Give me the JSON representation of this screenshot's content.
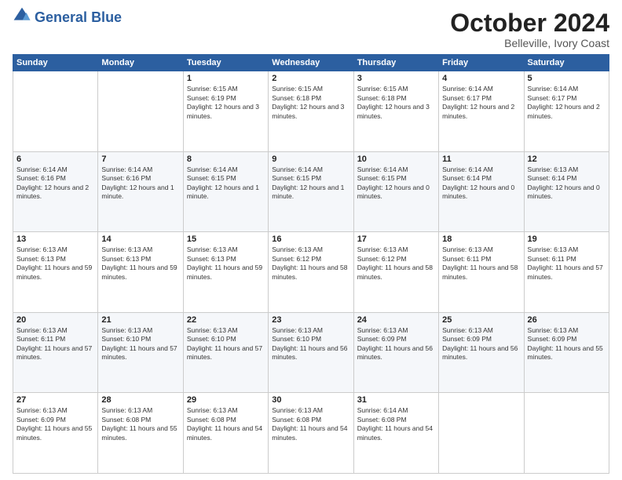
{
  "header": {
    "logo_line1": "General",
    "logo_line2": "Blue",
    "month_title": "October 2024",
    "location": "Belleville, Ivory Coast"
  },
  "weekdays": [
    "Sunday",
    "Monday",
    "Tuesday",
    "Wednesday",
    "Thursday",
    "Friday",
    "Saturday"
  ],
  "weeks": [
    [
      {
        "day": "",
        "sunrise": "",
        "sunset": "",
        "daylight": ""
      },
      {
        "day": "",
        "sunrise": "",
        "sunset": "",
        "daylight": ""
      },
      {
        "day": "1",
        "sunrise": "Sunrise: 6:15 AM",
        "sunset": "Sunset: 6:19 PM",
        "daylight": "Daylight: 12 hours and 3 minutes."
      },
      {
        "day": "2",
        "sunrise": "Sunrise: 6:15 AM",
        "sunset": "Sunset: 6:18 PM",
        "daylight": "Daylight: 12 hours and 3 minutes."
      },
      {
        "day": "3",
        "sunrise": "Sunrise: 6:15 AM",
        "sunset": "Sunset: 6:18 PM",
        "daylight": "Daylight: 12 hours and 3 minutes."
      },
      {
        "day": "4",
        "sunrise": "Sunrise: 6:14 AM",
        "sunset": "Sunset: 6:17 PM",
        "daylight": "Daylight: 12 hours and 2 minutes."
      },
      {
        "day": "5",
        "sunrise": "Sunrise: 6:14 AM",
        "sunset": "Sunset: 6:17 PM",
        "daylight": "Daylight: 12 hours and 2 minutes."
      }
    ],
    [
      {
        "day": "6",
        "sunrise": "Sunrise: 6:14 AM",
        "sunset": "Sunset: 6:16 PM",
        "daylight": "Daylight: 12 hours and 2 minutes."
      },
      {
        "day": "7",
        "sunrise": "Sunrise: 6:14 AM",
        "sunset": "Sunset: 6:16 PM",
        "daylight": "Daylight: 12 hours and 1 minute."
      },
      {
        "day": "8",
        "sunrise": "Sunrise: 6:14 AM",
        "sunset": "Sunset: 6:15 PM",
        "daylight": "Daylight: 12 hours and 1 minute."
      },
      {
        "day": "9",
        "sunrise": "Sunrise: 6:14 AM",
        "sunset": "Sunset: 6:15 PM",
        "daylight": "Daylight: 12 hours and 1 minute."
      },
      {
        "day": "10",
        "sunrise": "Sunrise: 6:14 AM",
        "sunset": "Sunset: 6:15 PM",
        "daylight": "Daylight: 12 hours and 0 minutes."
      },
      {
        "day": "11",
        "sunrise": "Sunrise: 6:14 AM",
        "sunset": "Sunset: 6:14 PM",
        "daylight": "Daylight: 12 hours and 0 minutes."
      },
      {
        "day": "12",
        "sunrise": "Sunrise: 6:13 AM",
        "sunset": "Sunset: 6:14 PM",
        "daylight": "Daylight: 12 hours and 0 minutes."
      }
    ],
    [
      {
        "day": "13",
        "sunrise": "Sunrise: 6:13 AM",
        "sunset": "Sunset: 6:13 PM",
        "daylight": "Daylight: 11 hours and 59 minutes."
      },
      {
        "day": "14",
        "sunrise": "Sunrise: 6:13 AM",
        "sunset": "Sunset: 6:13 PM",
        "daylight": "Daylight: 11 hours and 59 minutes."
      },
      {
        "day": "15",
        "sunrise": "Sunrise: 6:13 AM",
        "sunset": "Sunset: 6:13 PM",
        "daylight": "Daylight: 11 hours and 59 minutes."
      },
      {
        "day": "16",
        "sunrise": "Sunrise: 6:13 AM",
        "sunset": "Sunset: 6:12 PM",
        "daylight": "Daylight: 11 hours and 58 minutes."
      },
      {
        "day": "17",
        "sunrise": "Sunrise: 6:13 AM",
        "sunset": "Sunset: 6:12 PM",
        "daylight": "Daylight: 11 hours and 58 minutes."
      },
      {
        "day": "18",
        "sunrise": "Sunrise: 6:13 AM",
        "sunset": "Sunset: 6:11 PM",
        "daylight": "Daylight: 11 hours and 58 minutes."
      },
      {
        "day": "19",
        "sunrise": "Sunrise: 6:13 AM",
        "sunset": "Sunset: 6:11 PM",
        "daylight": "Daylight: 11 hours and 57 minutes."
      }
    ],
    [
      {
        "day": "20",
        "sunrise": "Sunrise: 6:13 AM",
        "sunset": "Sunset: 6:11 PM",
        "daylight": "Daylight: 11 hours and 57 minutes."
      },
      {
        "day": "21",
        "sunrise": "Sunrise: 6:13 AM",
        "sunset": "Sunset: 6:10 PM",
        "daylight": "Daylight: 11 hours and 57 minutes."
      },
      {
        "day": "22",
        "sunrise": "Sunrise: 6:13 AM",
        "sunset": "Sunset: 6:10 PM",
        "daylight": "Daylight: 11 hours and 57 minutes."
      },
      {
        "day": "23",
        "sunrise": "Sunrise: 6:13 AM",
        "sunset": "Sunset: 6:10 PM",
        "daylight": "Daylight: 11 hours and 56 minutes."
      },
      {
        "day": "24",
        "sunrise": "Sunrise: 6:13 AM",
        "sunset": "Sunset: 6:09 PM",
        "daylight": "Daylight: 11 hours and 56 minutes."
      },
      {
        "day": "25",
        "sunrise": "Sunrise: 6:13 AM",
        "sunset": "Sunset: 6:09 PM",
        "daylight": "Daylight: 11 hours and 56 minutes."
      },
      {
        "day": "26",
        "sunrise": "Sunrise: 6:13 AM",
        "sunset": "Sunset: 6:09 PM",
        "daylight": "Daylight: 11 hours and 55 minutes."
      }
    ],
    [
      {
        "day": "27",
        "sunrise": "Sunrise: 6:13 AM",
        "sunset": "Sunset: 6:09 PM",
        "daylight": "Daylight: 11 hours and 55 minutes."
      },
      {
        "day": "28",
        "sunrise": "Sunrise: 6:13 AM",
        "sunset": "Sunset: 6:08 PM",
        "daylight": "Daylight: 11 hours and 55 minutes."
      },
      {
        "day": "29",
        "sunrise": "Sunrise: 6:13 AM",
        "sunset": "Sunset: 6:08 PM",
        "daylight": "Daylight: 11 hours and 54 minutes."
      },
      {
        "day": "30",
        "sunrise": "Sunrise: 6:13 AM",
        "sunset": "Sunset: 6:08 PM",
        "daylight": "Daylight: 11 hours and 54 minutes."
      },
      {
        "day": "31",
        "sunrise": "Sunrise: 6:14 AM",
        "sunset": "Sunset: 6:08 PM",
        "daylight": "Daylight: 11 hours and 54 minutes."
      },
      {
        "day": "",
        "sunrise": "",
        "sunset": "",
        "daylight": ""
      },
      {
        "day": "",
        "sunrise": "",
        "sunset": "",
        "daylight": ""
      }
    ]
  ]
}
